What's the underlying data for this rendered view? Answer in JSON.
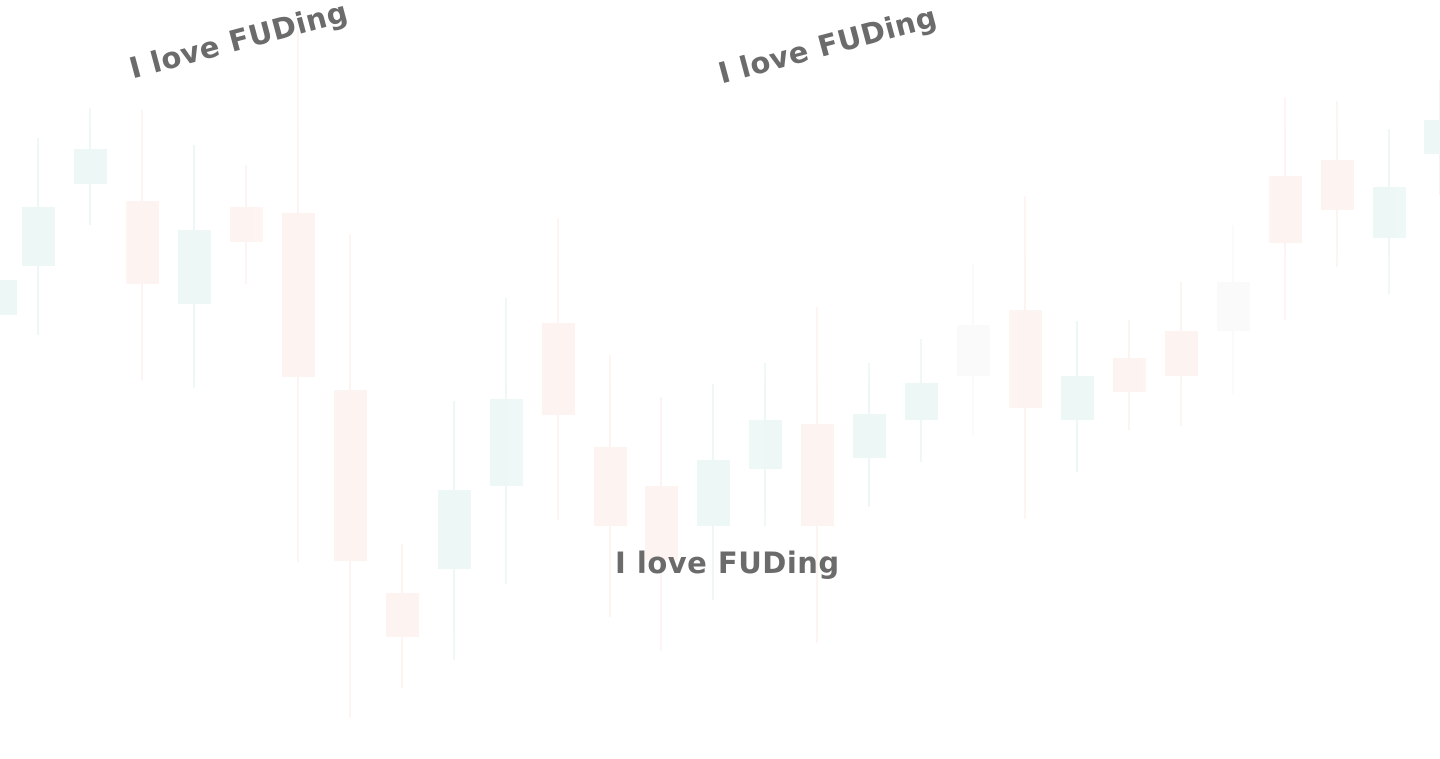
{
  "captions": {
    "top_left": "I love FUDing",
    "top_center": "I love FUDing",
    "center": "I love FUDing"
  },
  "colors": {
    "up": "#2bb39a",
    "down": "#f07a62",
    "neutral": "#c8c8c8",
    "text": "#6b6b6b",
    "background": "#ffffff"
  }
}
